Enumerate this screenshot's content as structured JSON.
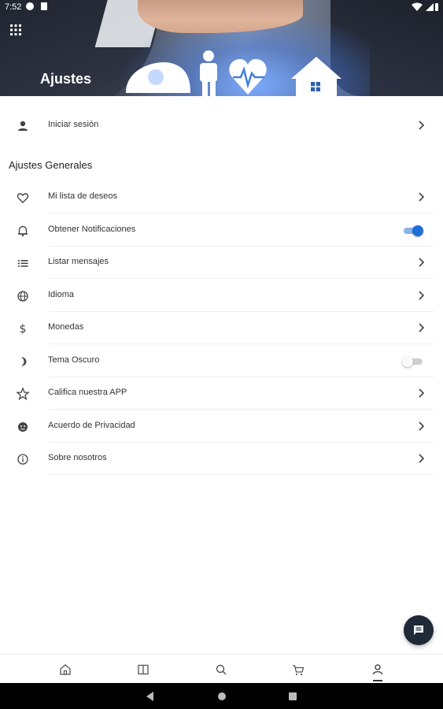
{
  "status_bar": {
    "time": "7:52"
  },
  "header": {
    "title": "Ajustes"
  },
  "login": {
    "label": "Iniciar sesión",
    "icon": "person-icon"
  },
  "section": {
    "title": "Ajustes Generales"
  },
  "settings": {
    "items": [
      {
        "label": "Mi lista de deseos",
        "icon": "heart-icon",
        "type": "link"
      },
      {
        "label": "Obtener Notificaciones",
        "icon": "bell-icon",
        "type": "toggle",
        "enabled": true
      },
      {
        "label": "Listar mensajes",
        "icon": "list-icon",
        "type": "link"
      },
      {
        "label": "Idioma",
        "icon": "globe-icon",
        "type": "link"
      },
      {
        "label": "Monedas",
        "icon": "dollar-icon",
        "type": "link"
      },
      {
        "label": "Tema Oscuro",
        "icon": "moon-icon",
        "type": "toggle",
        "enabled": false
      },
      {
        "label": "Califica nuestra APP",
        "icon": "star-icon",
        "type": "link"
      },
      {
        "label": "Acuerdo de Privacidad",
        "icon": "face-icon",
        "type": "link"
      },
      {
        "label": "Sobre nosotros",
        "icon": "info-icon",
        "type": "link"
      }
    ]
  },
  "colors": {
    "accent": "#1d6fd6",
    "fab": "#1f2937"
  },
  "tabs": [
    {
      "icon": "home-icon"
    },
    {
      "icon": "book-icon"
    },
    {
      "icon": "search-icon"
    },
    {
      "icon": "cart-icon"
    },
    {
      "icon": "profile-icon",
      "active": true
    }
  ]
}
